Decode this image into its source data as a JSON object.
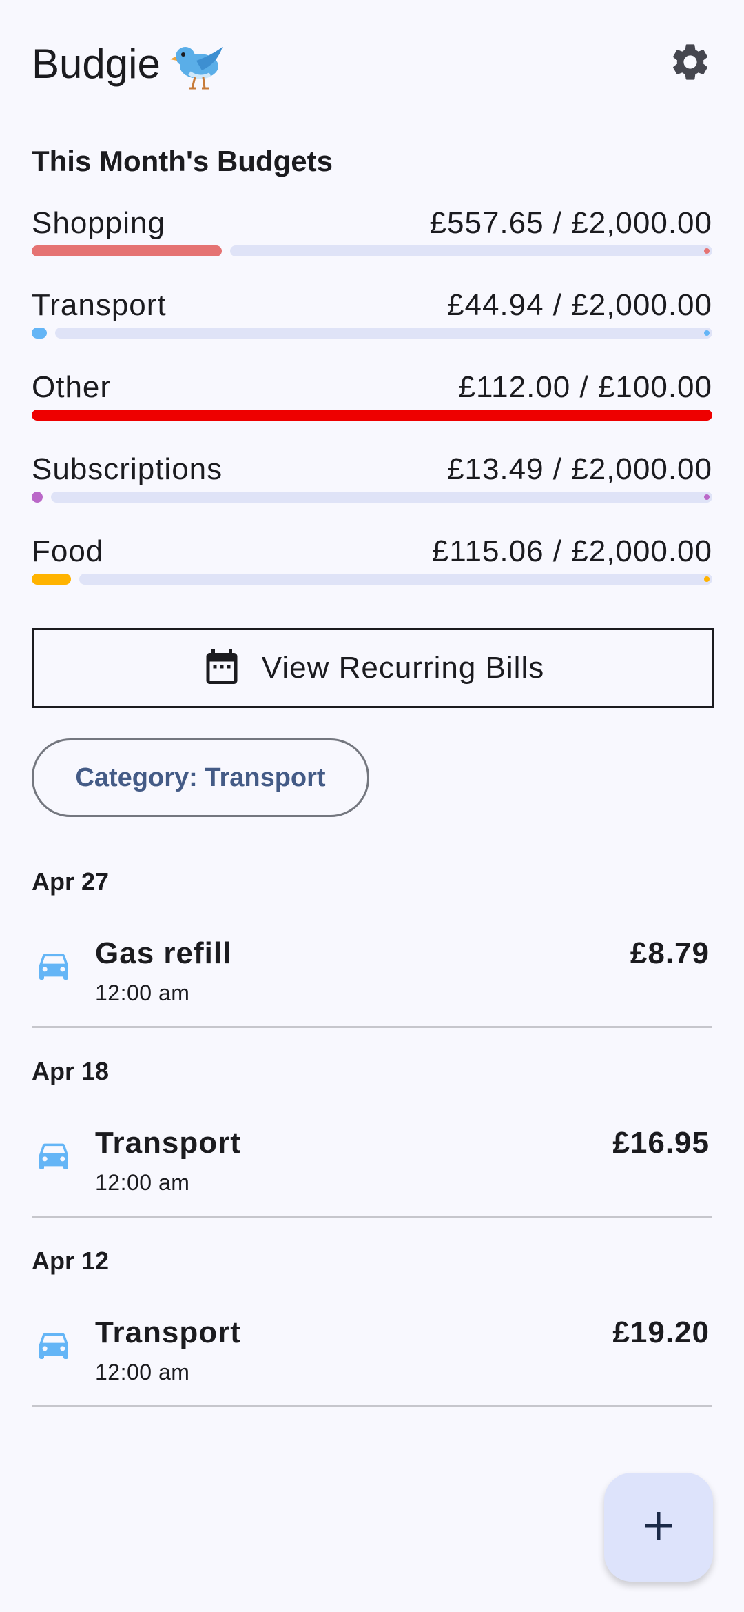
{
  "app": {
    "title": "Budgie"
  },
  "budgets": {
    "title": "This Month's Budgets",
    "items": [
      {
        "name": "Shopping",
        "amount": "£557.65 / £2,000.00",
        "progress": 0.279,
        "color": "#e57373"
      },
      {
        "name": "Transport",
        "amount": "£44.94 / £2,000.00",
        "progress": 0.022,
        "color": "#64b5f6"
      },
      {
        "name": "Other",
        "amount": "£112.00 / £100.00",
        "progress": 1.0,
        "color": "#ee0000"
      },
      {
        "name": "Subscriptions",
        "amount": "£13.49 / £2,000.00",
        "progress": 0.007,
        "color": "#ba68c8"
      },
      {
        "name": "Food",
        "amount": "£115.06 / £2,000.00",
        "progress": 0.058,
        "color": "#ffb300"
      }
    ]
  },
  "recurring_button": {
    "label": "View Recurring Bills"
  },
  "filter_chip": {
    "label": "Category: Transport"
  },
  "transactions": [
    {
      "date": "Apr 27",
      "title": "Gas refill",
      "time": "12:00 am",
      "amount": "£8.79",
      "icon": "car-icon"
    },
    {
      "date": "Apr 18",
      "title": "Transport",
      "time": "12:00 am",
      "amount": "£16.95",
      "icon": "car-icon"
    },
    {
      "date": "Apr 12",
      "title": "Transport",
      "time": "12:00 am",
      "amount": "£19.20",
      "icon": "car-icon"
    }
  ],
  "fab": {
    "icon": "plus-icon"
  }
}
